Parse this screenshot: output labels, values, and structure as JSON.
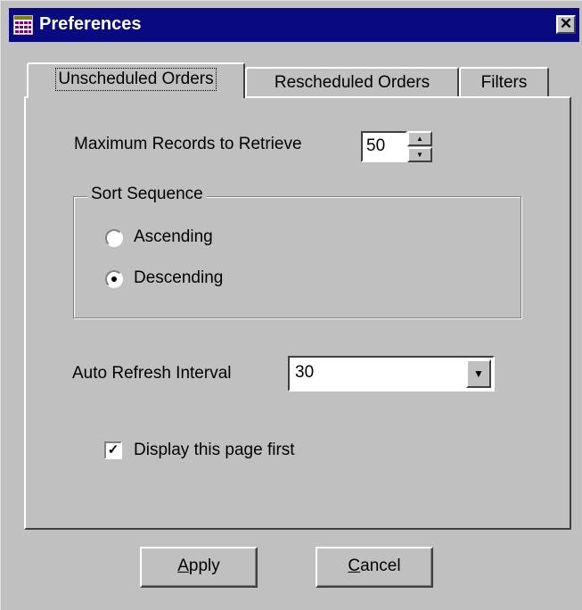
{
  "window": {
    "title": "Preferences",
    "close_glyph": "✕",
    "app_icon": "grid-icon"
  },
  "tabs": [
    {
      "label": "Unscheduled Orders",
      "active": true
    },
    {
      "label": "Rescheduled Orders",
      "active": false
    },
    {
      "label": "Filters",
      "active": false
    }
  ],
  "max_records": {
    "label": "Maximum Records to Retrieve",
    "value": "50"
  },
  "sort_sequence": {
    "legend": "Sort Sequence",
    "options": [
      {
        "label": "Ascending",
        "selected": false
      },
      {
        "label": "Descending",
        "selected": true
      }
    ]
  },
  "auto_refresh": {
    "label": "Auto Refresh Interval",
    "value": "30"
  },
  "display_first": {
    "label": "Display this page first",
    "checked": true
  },
  "buttons": {
    "apply": {
      "mnemonic": "A",
      "rest": "pply"
    },
    "cancel": {
      "mnemonic": "C",
      "rest": "ancel"
    }
  }
}
